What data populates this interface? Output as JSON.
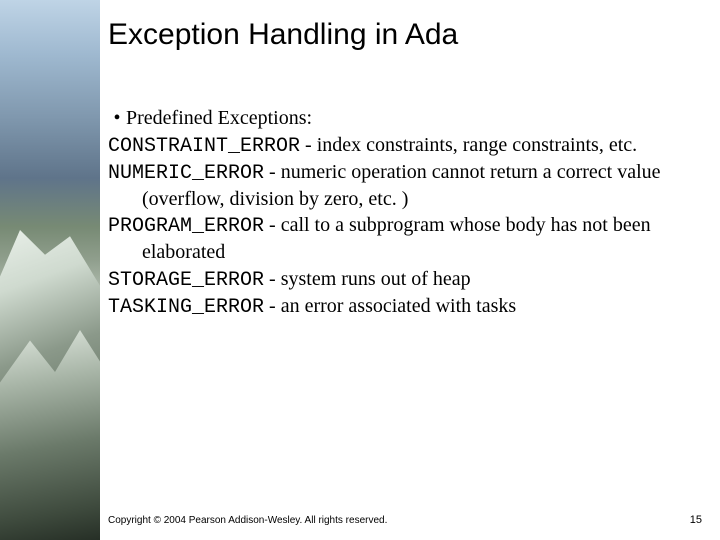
{
  "title": "Exception Handling in Ada",
  "bullet_label": "Predefined Exceptions:",
  "items": [
    {
      "code": "CONSTRAINT_ERROR",
      "desc": " - index constraints, range constraints, etc."
    },
    {
      "code": "NUMERIC_ERROR",
      "desc": " - numeric operation cannot return a correct value (overflow, division by zero, etc. )"
    },
    {
      "code": "PROGRAM_ERROR",
      "desc": " - call to a subprogram whose body has not been elaborated"
    },
    {
      "code": "STORAGE_ERROR",
      "desc": " - system runs out of heap"
    },
    {
      "code": "TASKING_ERROR",
      "desc": " - an error associated with tasks"
    }
  ],
  "footer": {
    "copyright": "Copyright © 2004 Pearson Addison-Wesley. All rights reserved.",
    "page": "15"
  }
}
